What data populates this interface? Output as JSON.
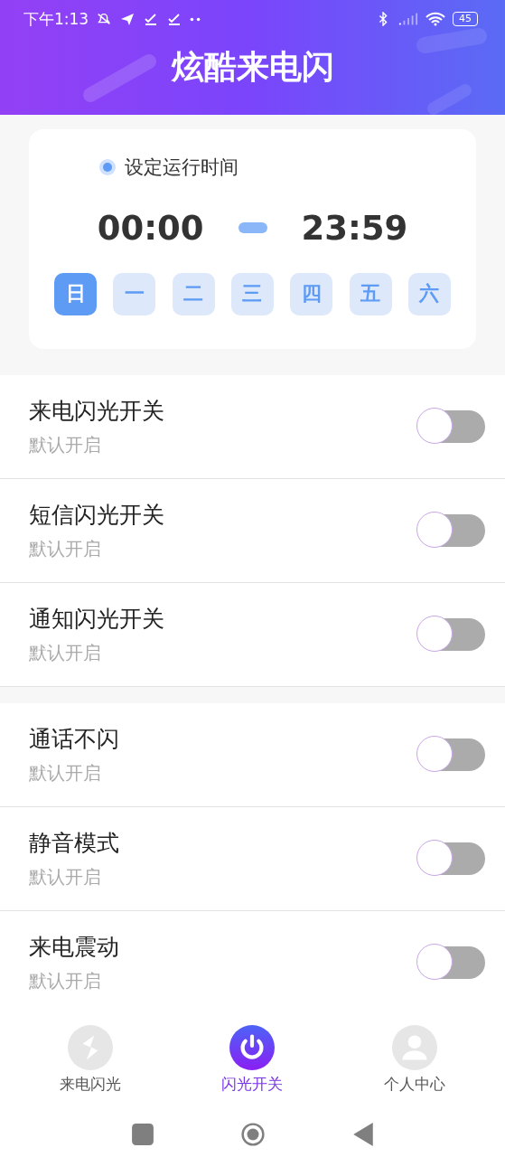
{
  "status_bar": {
    "time": "下午1:13",
    "battery": "45"
  },
  "header": {
    "title": "炫酷来电闪"
  },
  "schedule": {
    "label": "设定运行时间",
    "start": "00:00",
    "end": "23:59",
    "days": [
      {
        "label": "日",
        "selected": true
      },
      {
        "label": "一",
        "selected": false
      },
      {
        "label": "二",
        "selected": false
      },
      {
        "label": "三",
        "selected": false
      },
      {
        "label": "四",
        "selected": false
      },
      {
        "label": "五",
        "selected": false
      },
      {
        "label": "六",
        "selected": false
      }
    ]
  },
  "groups": [
    [
      {
        "title": "来电闪光开关",
        "subtitle": "默认开启",
        "on": false
      },
      {
        "title": "短信闪光开关",
        "subtitle": "默认开启",
        "on": false
      },
      {
        "title": "通知闪光开关",
        "subtitle": "默认开启",
        "on": false
      }
    ],
    [
      {
        "title": "通话不闪",
        "subtitle": "默认开启",
        "on": false
      },
      {
        "title": "静音模式",
        "subtitle": "默认开启",
        "on": false
      },
      {
        "title": "来电震动",
        "subtitle": "默认开启",
        "on": false
      }
    ]
  ],
  "tab_bar": [
    {
      "label": "来电闪光",
      "kind": "flash",
      "selected": false
    },
    {
      "label": "闪光开关",
      "kind": "power",
      "selected": true
    },
    {
      "label": "个人中心",
      "kind": "person",
      "selected": false
    }
  ]
}
